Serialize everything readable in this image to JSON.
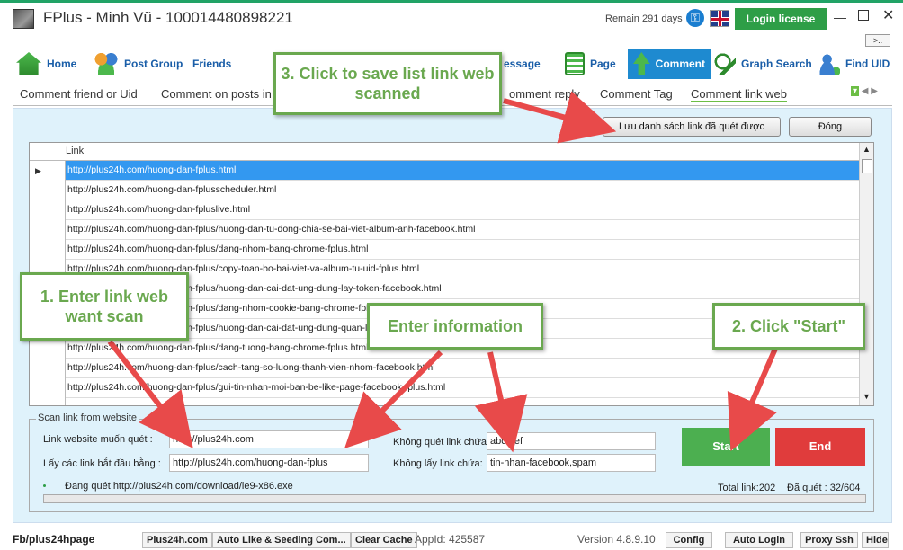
{
  "window": {
    "title": "FPlus - Minh Vũ - 100014480898221",
    "remain": "Remain 291 days",
    "login_license": "Login license",
    "more": ">..",
    "min": "—",
    "close": "✕"
  },
  "nav": {
    "items": [
      {
        "label": "Home"
      },
      {
        "label": "Post Group"
      },
      {
        "label": "Friends"
      },
      {
        "label": "essage"
      },
      {
        "label": "Page"
      },
      {
        "label": "Comment"
      },
      {
        "label": "Graph Search"
      },
      {
        "label": "Find UID"
      }
    ]
  },
  "subtabs": [
    {
      "label": "Comment friend or Uid"
    },
    {
      "label": "Comment on posts in"
    },
    {
      "label": "omment reply"
    },
    {
      "label": "Comment Tag"
    },
    {
      "label": "Comment link web"
    }
  ],
  "toolbar": {
    "save_list": "Lưu danh sách link đã quét được",
    "close": "Đóng"
  },
  "grid": {
    "header": "Link",
    "rows": [
      "http://plus24h.com/huong-dan-fplus.html",
      "http://plus24h.com/huong-dan-fplusscheduler.html",
      "http://plus24h.com/huong-dan-fpluslive.html",
      "http://plus24h.com/huong-dan-fplus/huong-dan-tu-dong-chia-se-bai-viet-album-anh-facebook.html",
      "http://plus24h.com/huong-dan-fplus/dang-nhom-bang-chrome-fplus.html",
      "http://plus24h.com/huong-dan-fplus/copy-toan-bo-bai-viet-va-album-tu-uid-fplus.html",
      "http://plus24h.com/huong-dan-fplus/huong-dan-cai-dat-ung-dung-lay-token-facebook.html",
      "http://plus24h.com/huong-dan-fplus/dang-nhom-cookie-bang-chrome-fplus.html",
      "http://plus24h.com/huong-dan-fplus/huong-dan-cai-dat-ung-dung-quan-ly-facebook.html",
      "http://plus24h.com/huong-dan-fplus/dang-tuong-bang-chrome-fplus.html",
      "http://plus24h.com/huong-dan-fplus/cach-tang-so-luong-thanh-vien-nhom-facebook.html",
      "http://plus24h.com/huong-dan-fplus/gui-tin-nhan-moi-ban-be-like-page-facebook-fplus.html"
    ]
  },
  "scan": {
    "legend": "Scan link from website",
    "website_label": "Link website muốn quét :",
    "website_value": "http://plus24h.com",
    "prefix_label": "Lấy các link bắt đầu bằng :",
    "prefix_value": "http://plus24h.com/huong-dan-fplus",
    "exclude_label": "Không quét link chứa:",
    "exclude_value": "abc,def",
    "skip_label": "Không lấy link chứa:",
    "skip_value": "tin-nhan-facebook,spam",
    "start": "Start",
    "end": "End",
    "status": "Đang quét http://plus24h.com/download/ie9-x86.exe",
    "total": "Total link:202",
    "scanned": "Đã quét : 32/604"
  },
  "statusbar": {
    "fb": "Fb/plus24hpage",
    "plus24h": "Plus24h.com",
    "auto_like": "Auto Like & Seeding Com...",
    "clear_cache": "Clear Cache",
    "appid": "AppId: 425587",
    "version": "Version 4.8.9.10",
    "config": "Config",
    "auto_login": "Auto Login",
    "proxy": "Proxy Ssh",
    "hide": "Hide"
  },
  "annotations": {
    "step1": "1. Enter link web want scan",
    "step2": "2. Click \"Start\"",
    "step3": "3. Click to save list link web scanned",
    "info": "Enter information"
  },
  "colors": {
    "accent": "#1e8ad0",
    "start": "#4caf50",
    "end": "#e03c3c",
    "callout": "#6aa84f",
    "arrow": "#e84a4a"
  }
}
